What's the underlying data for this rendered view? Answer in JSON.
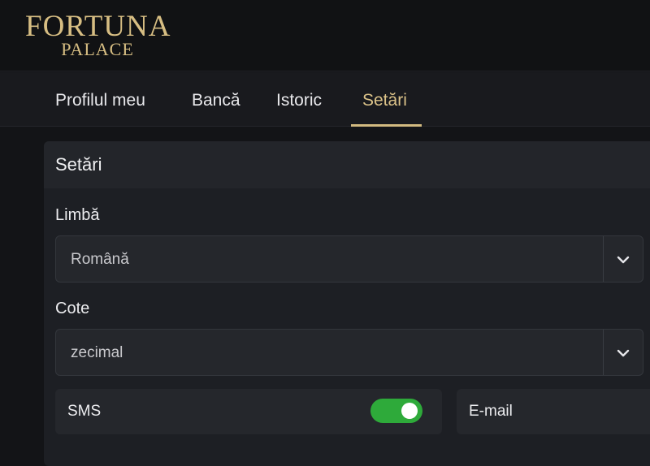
{
  "brand": {
    "name_main": "FORTUNA",
    "name_sub": "PALACE",
    "accent_color": "#d7be83"
  },
  "nav": {
    "tabs": [
      {
        "label": "Profilul meu",
        "active": false
      },
      {
        "label": "Bancă",
        "active": false
      },
      {
        "label": "Istoric",
        "active": false
      },
      {
        "label": "Setări",
        "active": true
      }
    ]
  },
  "settings": {
    "title": "Setări",
    "language": {
      "label": "Limbă",
      "value": "Română",
      "icon": "chevron-down-icon"
    },
    "odds": {
      "label": "Cote",
      "value": "zecimal",
      "icon": "chevron-down-icon"
    },
    "notifications": {
      "sms": {
        "label": "SMS",
        "enabled": true,
        "on_color": "#2eaa3a"
      },
      "email": {
        "label": "E-mail"
      }
    }
  }
}
